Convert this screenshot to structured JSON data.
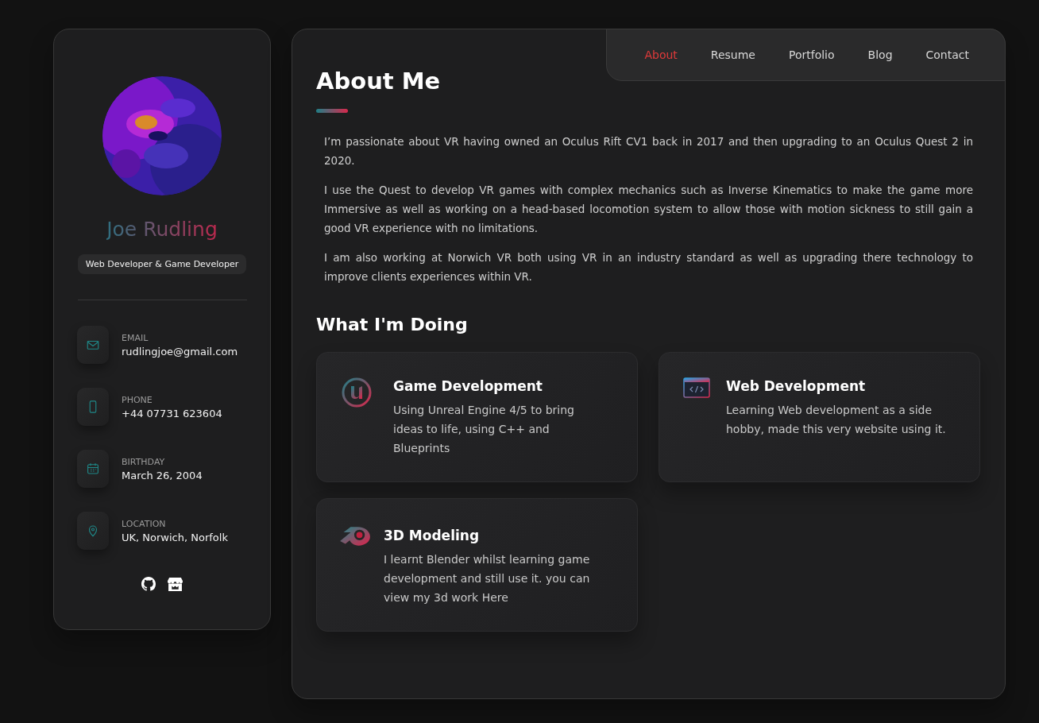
{
  "profile": {
    "name": "Joe Rudling",
    "title": "Web Developer & Game Developer"
  },
  "contacts": [
    {
      "kind": "email",
      "label": "EMAIL",
      "value": "rudlingjoe@gmail.com"
    },
    {
      "kind": "phone",
      "label": "PHONE",
      "value": "+44 07731 623604"
    },
    {
      "kind": "birthday",
      "label": "BIRTHDAY",
      "value": "March 26, 2004"
    },
    {
      "kind": "location",
      "label": "LOCATION",
      "value": "UK, Norwich, Norfolk"
    }
  ],
  "socials": [
    {
      "kind": "github"
    },
    {
      "kind": "store"
    }
  ],
  "nav": [
    {
      "label": "About",
      "selected": true
    },
    {
      "label": "Resume",
      "selected": false
    },
    {
      "label": "Portfolio",
      "selected": false
    },
    {
      "label": "Blog",
      "selected": false
    },
    {
      "label": "Contact",
      "selected": false
    }
  ],
  "about": {
    "title": "About Me",
    "paragraphs": [
      "I’m passionate about VR having owned an Oculus Rift CV1 back in 2017 and then upgrading to an Oculus Quest 2 in 2020.",
      "I use the Quest to develop VR games with complex mechanics such as Inverse Kinematics to make the game more Immersive as well as working on a head-based locomotion system to allow those with motion sickness to still gain a good VR experience with no limitations.",
      "I am also working at Norwich VR both using VR in an industry standard as well as upgrading there technology to improve clients experiences within VR."
    ]
  },
  "services": {
    "title": "What I'm Doing",
    "items": [
      {
        "kind": "unreal",
        "title": "Game Development",
        "text": "Using Unreal Engine 4/5 to bring ideas to life, using C++ and Blueprints"
      },
      {
        "kind": "web",
        "title": "Web Development",
        "text": "Learning Web development as a side hobby, made this very website using it."
      },
      {
        "kind": "blender",
        "title": "3D Modeling",
        "text": "I learnt Blender whilst learning game development and still use it. you can view my 3d work Here"
      }
    ]
  }
}
